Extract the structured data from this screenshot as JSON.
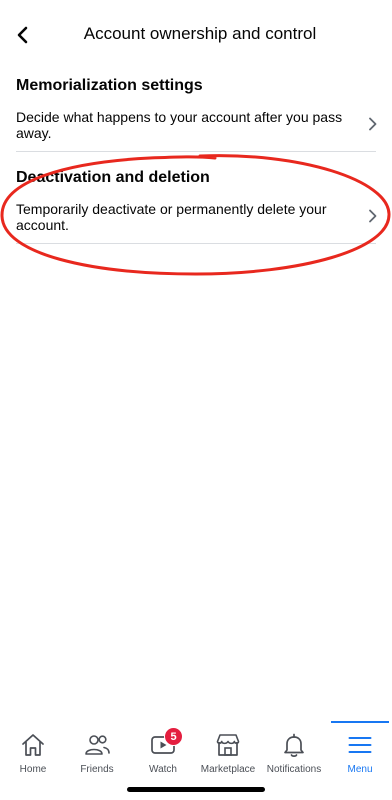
{
  "header": {
    "title": "Account ownership and control",
    "back_icon": "chevron-left-icon"
  },
  "sections": [
    {
      "heading": "Memorialization settings",
      "description": "Decide what happens to your account after you pass away."
    },
    {
      "heading": "Deactivation and deletion",
      "description": "Temporarily deactivate or permanently delete your account."
    }
  ],
  "annotation": {
    "color": "#e8281e",
    "shape": "hand-drawn-ellipse"
  },
  "tabbar": {
    "items": [
      {
        "label": "Home",
        "icon": "home-icon"
      },
      {
        "label": "Friends",
        "icon": "friends-icon"
      },
      {
        "label": "Watch",
        "icon": "watch-icon",
        "badge": "5"
      },
      {
        "label": "Marketplace",
        "icon": "marketplace-icon"
      },
      {
        "label": "Notifications",
        "icon": "bell-icon"
      },
      {
        "label": "Menu",
        "icon": "menu-icon",
        "active": true
      }
    ],
    "accent": "#1877f2",
    "badge_color": "#e41e3f"
  }
}
